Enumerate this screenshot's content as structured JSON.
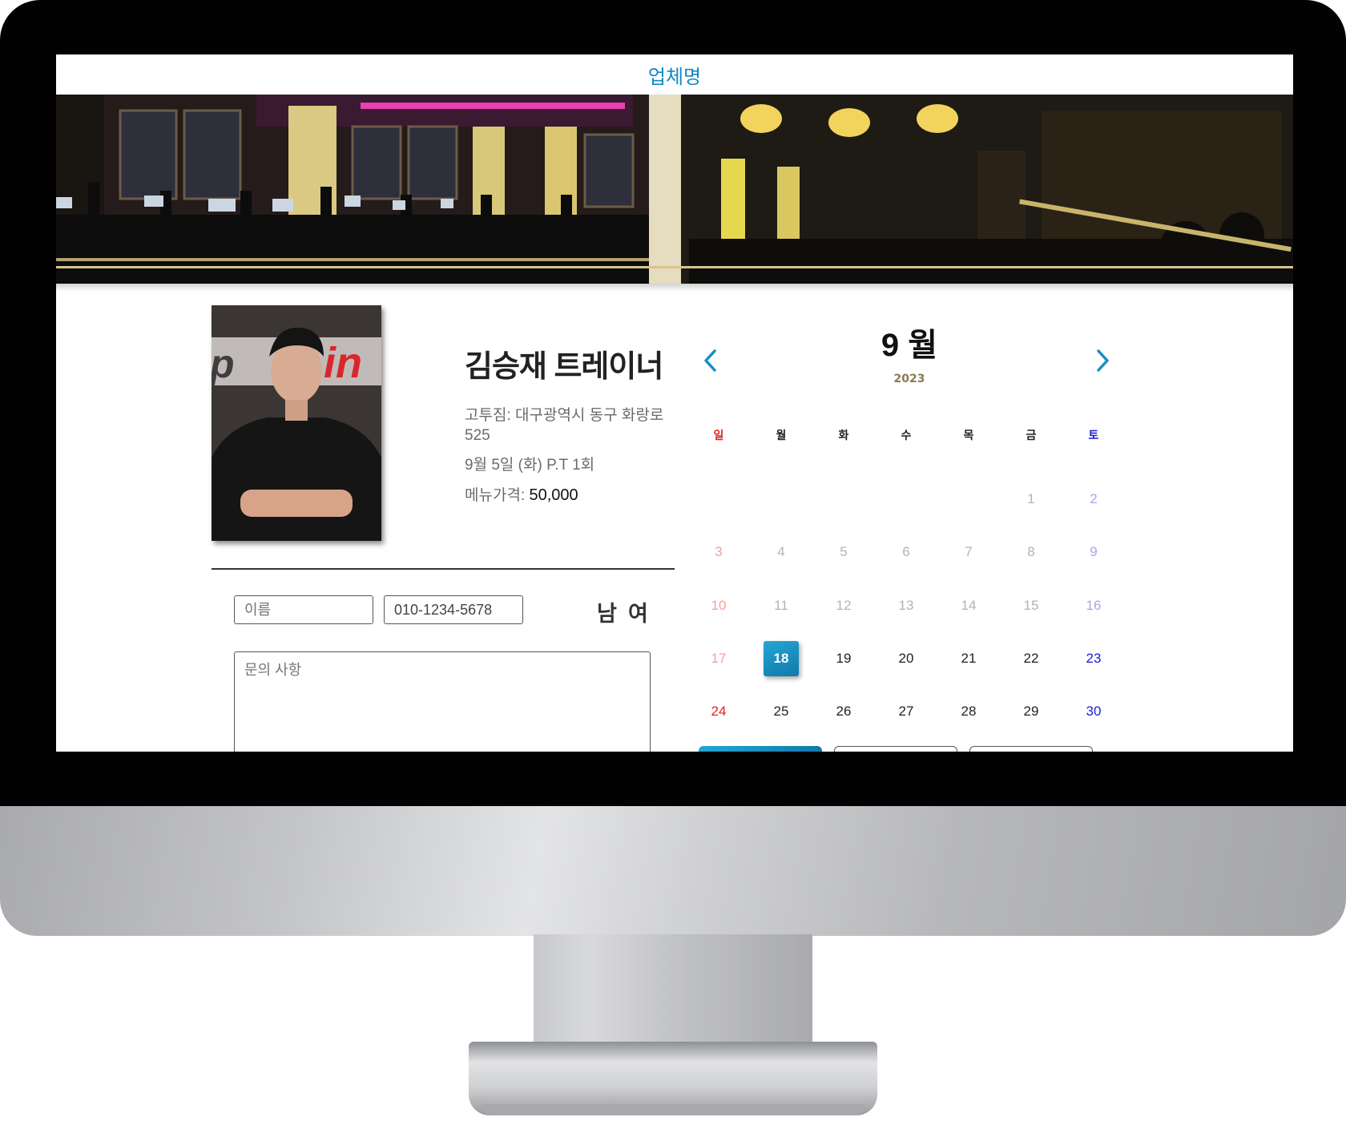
{
  "header": {
    "brand": "업체명"
  },
  "trainer": {
    "name": "김승재 트레이너",
    "address": "고투짐: 대구광역시 동구 화랑로 525",
    "session": "9월 5일 (화) P.T 1회",
    "price_label": "메뉴가격:",
    "price_value": "50,000"
  },
  "form": {
    "name_placeholder": "이름",
    "phone_value": "010-1234-5678",
    "gender_male": "남",
    "gender_female": "여",
    "inquiry_placeholder": "문의 사항"
  },
  "calendar": {
    "month": "9 월",
    "year": "2023",
    "weekdays": [
      "일",
      "월",
      "화",
      "수",
      "목",
      "금",
      "토"
    ],
    "selected_day": 18,
    "prev_icon": "chevron-left",
    "next_icon": "chevron-right",
    "accent_color": "#1a8fc4"
  }
}
